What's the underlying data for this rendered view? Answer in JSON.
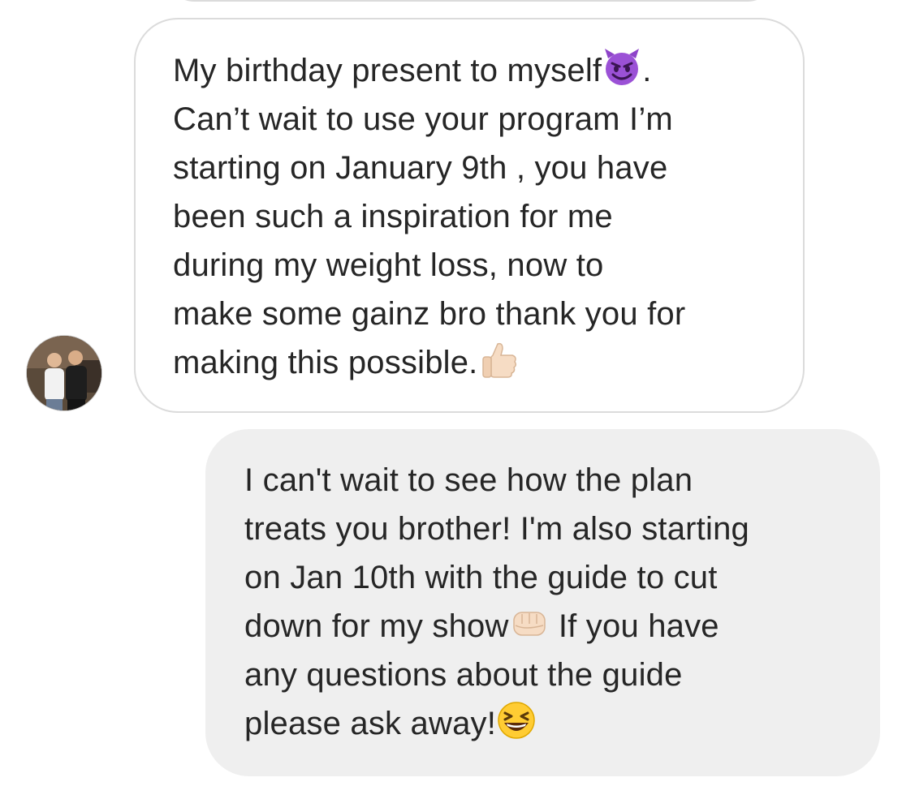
{
  "conversation": {
    "incoming": {
      "lines": [
        "My birthday present to myself",
        ".",
        "Can’t wait to use your program I’m",
        "starting on January 9th , you have",
        "been such a inspiration for me",
        "during my weight loss, now to",
        "make some gainz bro thank you for",
        "making this possible."
      ],
      "emojis": [
        "smiling-imp-emoji",
        "thumbs-up-emoji"
      ]
    },
    "outgoing": {
      "lines": [
        "I can't wait to see how the plan",
        "treats you brother! I'm also starting",
        "on Jan 10th with the guide to cut",
        "down for my show",
        " If you have",
        "any questions about the guide",
        "please ask away!"
      ],
      "emojis": [
        "oncoming-fist-emoji",
        "grinning-squinting-face-emoji"
      ]
    }
  },
  "colors": {
    "incoming_border": "#dbdbdb",
    "outgoing_bg": "#efefef",
    "text": "#262626"
  }
}
